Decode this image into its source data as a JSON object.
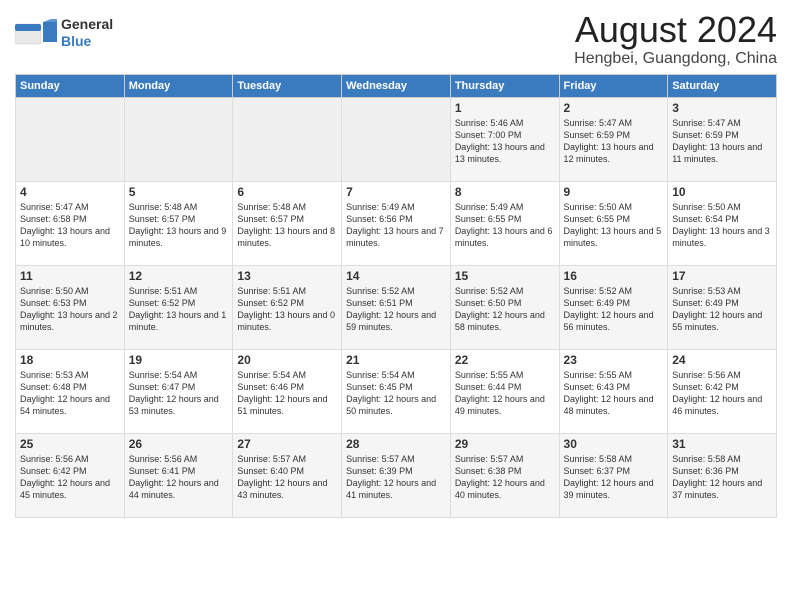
{
  "header": {
    "logo_general": "General",
    "logo_blue": "Blue",
    "title": "August 2024",
    "subtitle": "Hengbei, Guangdong, China"
  },
  "calendar": {
    "days_of_week": [
      "Sunday",
      "Monday",
      "Tuesday",
      "Wednesday",
      "Thursday",
      "Friday",
      "Saturday"
    ],
    "weeks": [
      [
        {
          "day": "",
          "content": ""
        },
        {
          "day": "",
          "content": ""
        },
        {
          "day": "",
          "content": ""
        },
        {
          "day": "",
          "content": ""
        },
        {
          "day": "1",
          "content": "Sunrise: 5:46 AM\nSunset: 7:00 PM\nDaylight: 13 hours\nand 13 minutes."
        },
        {
          "day": "2",
          "content": "Sunrise: 5:47 AM\nSunset: 6:59 PM\nDaylight: 13 hours\nand 12 minutes."
        },
        {
          "day": "3",
          "content": "Sunrise: 5:47 AM\nSunset: 6:59 PM\nDaylight: 13 hours\nand 11 minutes."
        }
      ],
      [
        {
          "day": "4",
          "content": "Sunrise: 5:47 AM\nSunset: 6:58 PM\nDaylight: 13 hours\nand 10 minutes."
        },
        {
          "day": "5",
          "content": "Sunrise: 5:48 AM\nSunset: 6:57 PM\nDaylight: 13 hours\nand 9 minutes."
        },
        {
          "day": "6",
          "content": "Sunrise: 5:48 AM\nSunset: 6:57 PM\nDaylight: 13 hours\nand 8 minutes."
        },
        {
          "day": "7",
          "content": "Sunrise: 5:49 AM\nSunset: 6:56 PM\nDaylight: 13 hours\nand 7 minutes."
        },
        {
          "day": "8",
          "content": "Sunrise: 5:49 AM\nSunset: 6:55 PM\nDaylight: 13 hours\nand 6 minutes."
        },
        {
          "day": "9",
          "content": "Sunrise: 5:50 AM\nSunset: 6:55 PM\nDaylight: 13 hours\nand 5 minutes."
        },
        {
          "day": "10",
          "content": "Sunrise: 5:50 AM\nSunset: 6:54 PM\nDaylight: 13 hours\nand 3 minutes."
        }
      ],
      [
        {
          "day": "11",
          "content": "Sunrise: 5:50 AM\nSunset: 6:53 PM\nDaylight: 13 hours\nand 2 minutes."
        },
        {
          "day": "12",
          "content": "Sunrise: 5:51 AM\nSunset: 6:52 PM\nDaylight: 13 hours\nand 1 minute."
        },
        {
          "day": "13",
          "content": "Sunrise: 5:51 AM\nSunset: 6:52 PM\nDaylight: 13 hours\nand 0 minutes."
        },
        {
          "day": "14",
          "content": "Sunrise: 5:52 AM\nSunset: 6:51 PM\nDaylight: 12 hours\nand 59 minutes."
        },
        {
          "day": "15",
          "content": "Sunrise: 5:52 AM\nSunset: 6:50 PM\nDaylight: 12 hours\nand 58 minutes."
        },
        {
          "day": "16",
          "content": "Sunrise: 5:52 AM\nSunset: 6:49 PM\nDaylight: 12 hours\nand 56 minutes."
        },
        {
          "day": "17",
          "content": "Sunrise: 5:53 AM\nSunset: 6:49 PM\nDaylight: 12 hours\nand 55 minutes."
        }
      ],
      [
        {
          "day": "18",
          "content": "Sunrise: 5:53 AM\nSunset: 6:48 PM\nDaylight: 12 hours\nand 54 minutes."
        },
        {
          "day": "19",
          "content": "Sunrise: 5:54 AM\nSunset: 6:47 PM\nDaylight: 12 hours\nand 53 minutes."
        },
        {
          "day": "20",
          "content": "Sunrise: 5:54 AM\nSunset: 6:46 PM\nDaylight: 12 hours\nand 51 minutes."
        },
        {
          "day": "21",
          "content": "Sunrise: 5:54 AM\nSunset: 6:45 PM\nDaylight: 12 hours\nand 50 minutes."
        },
        {
          "day": "22",
          "content": "Sunrise: 5:55 AM\nSunset: 6:44 PM\nDaylight: 12 hours\nand 49 minutes."
        },
        {
          "day": "23",
          "content": "Sunrise: 5:55 AM\nSunset: 6:43 PM\nDaylight: 12 hours\nand 48 minutes."
        },
        {
          "day": "24",
          "content": "Sunrise: 5:56 AM\nSunset: 6:42 PM\nDaylight: 12 hours\nand 46 minutes."
        }
      ],
      [
        {
          "day": "25",
          "content": "Sunrise: 5:56 AM\nSunset: 6:42 PM\nDaylight: 12 hours\nand 45 minutes."
        },
        {
          "day": "26",
          "content": "Sunrise: 5:56 AM\nSunset: 6:41 PM\nDaylight: 12 hours\nand 44 minutes."
        },
        {
          "day": "27",
          "content": "Sunrise: 5:57 AM\nSunset: 6:40 PM\nDaylight: 12 hours\nand 43 minutes."
        },
        {
          "day": "28",
          "content": "Sunrise: 5:57 AM\nSunset: 6:39 PM\nDaylight: 12 hours\nand 41 minutes."
        },
        {
          "day": "29",
          "content": "Sunrise: 5:57 AM\nSunset: 6:38 PM\nDaylight: 12 hours\nand 40 minutes."
        },
        {
          "day": "30",
          "content": "Sunrise: 5:58 AM\nSunset: 6:37 PM\nDaylight: 12 hours\nand 39 minutes."
        },
        {
          "day": "31",
          "content": "Sunrise: 5:58 AM\nSunset: 6:36 PM\nDaylight: 12 hours\nand 37 minutes."
        }
      ]
    ]
  }
}
